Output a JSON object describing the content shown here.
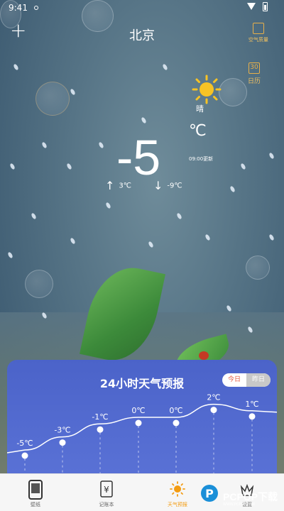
{
  "status_bar": {
    "time": "9:41"
  },
  "header": {
    "city": "北京",
    "air_quality_label": "空气质量",
    "calendar_label": "日历",
    "calendar_icon_text": "30"
  },
  "current": {
    "condition": "晴",
    "temperature": "-5",
    "unit": "℃",
    "updated": "09:00更新",
    "high": "3℃",
    "low": "-9℃"
  },
  "forecast": {
    "title": "24小时天气预报",
    "toggle_today": "今日",
    "toggle_yesterday": "昨日"
  },
  "chart_data": {
    "type": "line",
    "values": [
      -5,
      -3,
      -1,
      0,
      0,
      2,
      1
    ],
    "labels": [
      "-5℃",
      "-3℃",
      "-1℃",
      "0℃",
      "0℃",
      "2℃",
      "1℃"
    ]
  },
  "nav": {
    "items": [
      {
        "label": "壁纸",
        "icon": "phone-wallpaper-icon"
      },
      {
        "label": "记账本",
        "icon": "yuan-ledger-icon"
      },
      {
        "label": "天气预报",
        "icon": "sun-icon",
        "active": true
      },
      {
        "label": "设置",
        "icon": "settings-icon"
      }
    ]
  },
  "watermark": {
    "text": "PCPOP下载",
    "sub": "WWW.PCPOP.COM"
  },
  "colors": {
    "accent": "#f39c12",
    "panel": "#4b63c9",
    "icon_gold": "#e8b04a"
  }
}
